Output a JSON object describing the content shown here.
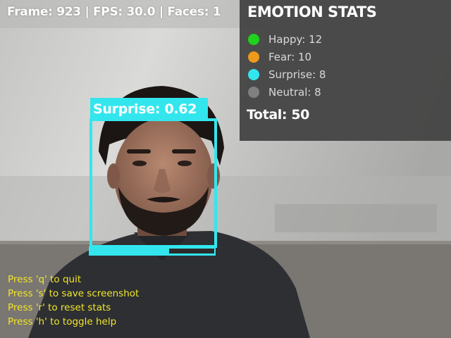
{
  "overlay": {
    "frame_info": "Frame: 923 | FPS: 30.0 | Faces: 1"
  },
  "stats": {
    "title": "EMOTION STATS",
    "items": [
      {
        "label": "Happy: 12",
        "color": "#1ed21e"
      },
      {
        "label": "Fear: 10",
        "color": "#ee9a1c"
      },
      {
        "label": "Surprise: 8",
        "color": "#33e6ee"
      },
      {
        "label": "Neutral: 8",
        "color": "#808080"
      }
    ],
    "total": "Total: 50"
  },
  "detection": {
    "label": "Surprise: 0.62",
    "confidence": 0.62,
    "color": "#33e6ee"
  },
  "help": {
    "lines": [
      "Press 'q' to quit",
      "Press 's' to save screenshot",
      "Press 'r' to reset stats",
      "Press 'h' to toggle help"
    ],
    "color": "#f0e62a"
  }
}
